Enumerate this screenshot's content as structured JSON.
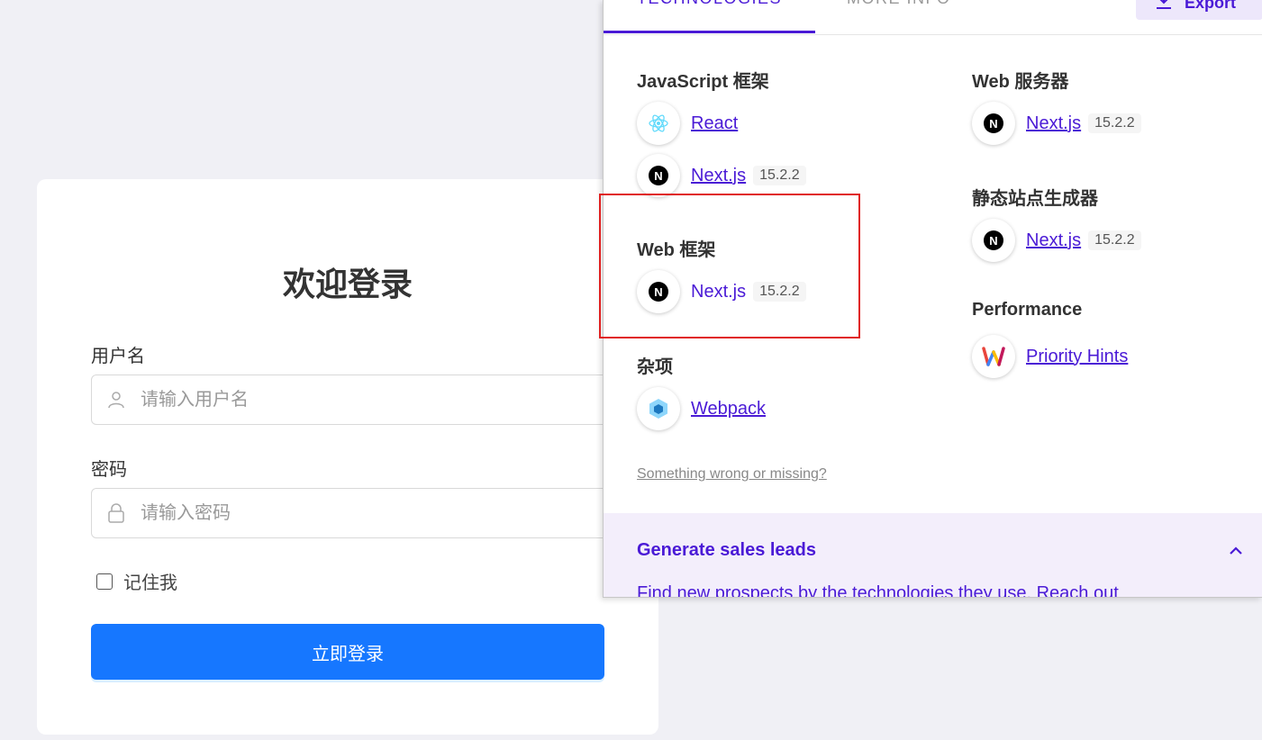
{
  "login": {
    "title": "欢迎登录",
    "username_label": "用户名",
    "username_placeholder": "请输入用户名",
    "password_label": "密码",
    "password_placeholder": "请输入密码",
    "remember_label": "记住我",
    "submit_label": "立即登录"
  },
  "panel": {
    "tabs": [
      {
        "label": "TECHNOLOGIES",
        "active": true
      },
      {
        "label": "MORE INFO",
        "active": false
      }
    ],
    "export_label": "Export",
    "categories": {
      "js_frameworks": {
        "title": "JavaScript 框架",
        "items": [
          {
            "name": "React",
            "version": "",
            "icon": "react-icon"
          },
          {
            "name": "Next.js",
            "version": "15.2.2",
            "icon": "nextjs-icon"
          }
        ]
      },
      "web_frameworks": {
        "title": "Web 框架",
        "items": [
          {
            "name": "Next.js",
            "version": "15.2.2",
            "icon": "nextjs-icon"
          }
        ]
      },
      "misc": {
        "title": "杂项",
        "items": [
          {
            "name": "Webpack",
            "version": "",
            "icon": "webpack-icon"
          }
        ]
      },
      "web_servers": {
        "title": "Web 服务器",
        "items": [
          {
            "name": "Next.js",
            "version": "15.2.2",
            "icon": "nextjs-icon"
          }
        ]
      },
      "static_site_generators": {
        "title": "静态站点生成器",
        "items": [
          {
            "name": "Next.js",
            "version": "15.2.2",
            "icon": "nextjs-icon"
          }
        ]
      },
      "performance": {
        "title": "Performance",
        "items": [
          {
            "name": "Priority Hints",
            "version": "",
            "icon": "priority-hints-icon"
          }
        ]
      }
    },
    "wrong_link": "Something wrong or missing?",
    "sales": {
      "title": "Generate sales leads",
      "text": "Find new prospects by the technologies they use. Reach out"
    }
  },
  "colors": {
    "accent": "#4a1ad6",
    "primary_button": "#1677ff",
    "highlight_border": "#e02020"
  }
}
